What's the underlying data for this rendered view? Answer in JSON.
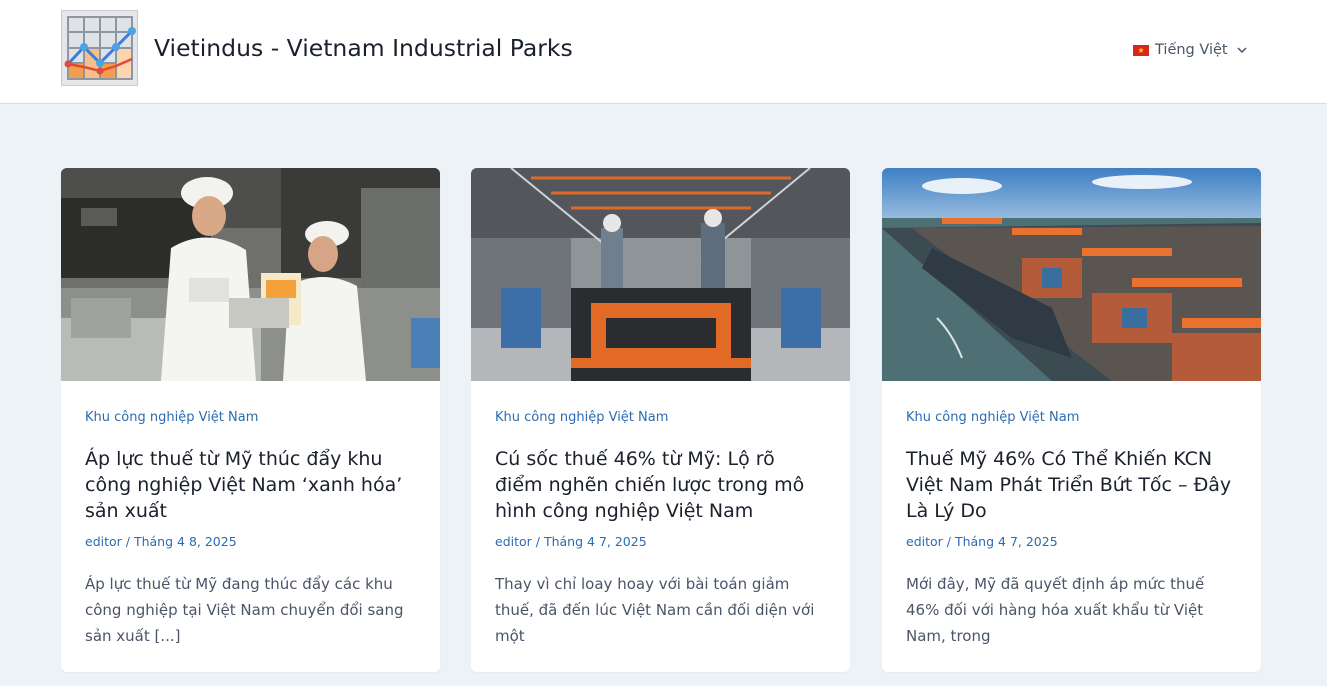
{
  "header": {
    "site_title": "Vietindus - Vietnam Industrial Parks",
    "logo_icon": "line-chart-grid-icon",
    "language": {
      "label": "Tiếng Việt",
      "flag_icon": "vietnam-flag-icon",
      "chevron_icon": "chevron-down-icon"
    }
  },
  "colors": {
    "page_bg": "#edf2f7",
    "accent": "#2b6cb0",
    "title": "#1a202c",
    "text": "#4a5568"
  },
  "posts": [
    {
      "category": "Khu công nghiệp Việt Nam",
      "title": "Áp lực thuế từ Mỹ thúc đẩy khu công nghiệp Việt Nam ‘xanh hóa’ sản xuất",
      "author": "editor",
      "separator": "/",
      "date": "Tháng 4 8, 2025",
      "excerpt": "Áp lực thuế từ Mỹ đang thúc đẩy các khu công nghiệp tại Việt Nam chuyển đổi sang sản xuất [...]",
      "image": "factory-workers-packaging-photo"
    },
    {
      "category": "Khu công nghiệp Việt Nam",
      "title": "Cú sốc thuế 46% từ Mỹ: Lộ rõ điểm nghẽn chiến lược trong mô hình công nghiệp Việt Nam",
      "author": "editor",
      "separator": "/",
      "date": "Tháng 4 7, 2025",
      "excerpt": "Thay vì chỉ loay hoay với bài toán giảm thuế, đã đến lúc Việt Nam cần đối diện với một",
      "image": "car-assembly-line-photo"
    },
    {
      "category": "Khu công nghiệp Việt Nam",
      "title": "Thuế Mỹ 46% Có Thể Khiến KCN Việt Nam Phát Triển Bứt Tốc – Đây Là Lý Do",
      "author": "editor",
      "separator": "/",
      "date": "Tháng 4 7, 2025",
      "excerpt": "Mới đây, Mỹ đã quyết định áp mức thuế 46% đối với hàng hóa xuất khẩu từ Việt Nam, trong",
      "image": "container-port-aerial-photo"
    }
  ]
}
